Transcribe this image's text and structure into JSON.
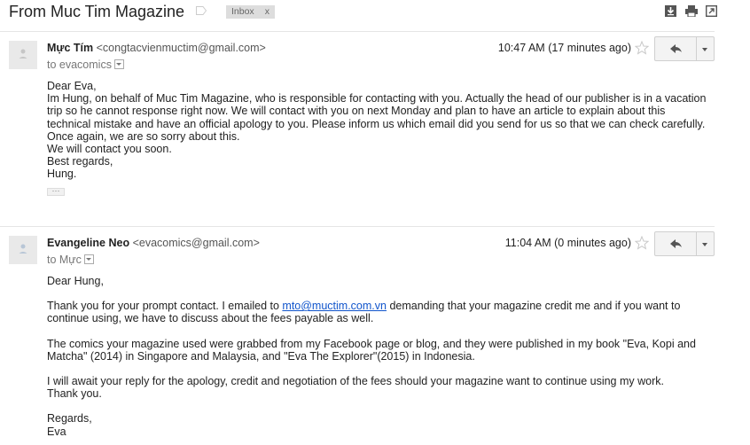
{
  "subject": "From Muc Tim Magazine",
  "label_chip": {
    "text": "Inbox",
    "close": "x"
  },
  "toolbar_icons": [
    "download-icon",
    "print-icon",
    "new-window-icon"
  ],
  "messages": [
    {
      "sender_name": "Mực Tím",
      "sender_email": "<congtacvienmuctim@gmail.com>",
      "recipient": "to evacomics",
      "time": "10:47 AM (17 minutes ago)",
      "body": [
        "Dear Eva,",
        "Im Hung, on behalf of Muc Tim Magazine, who is responsible for contacting with you. Actually the head of our publisher is in a vacation trip so he cannot response right now. We will contact with you on next Monday and plan to have an article to explain about this technical mistake and have an official apology to you. Please inform us which email did you send for us so that we can check carefully.",
        "Once again, we are so sorry about this.",
        "We will contact you soon.",
        "Best regards,",
        "Hung."
      ],
      "trimmed_content_indicator": "···"
    },
    {
      "sender_name": "Evangeline Neo",
      "sender_email": "<evacomics@gmail.com>",
      "recipient": "to Mực",
      "time": "11:04 AM (0 minutes ago)",
      "greeting": "Dear Hung,",
      "p1_before": "Thank you for your prompt contact. I emailed to ",
      "p1_link": "mto@muctim.com.vn",
      "p1_after": " demanding that your magazine credit me and if you want to continue using, we have to discuss about the fees payable as well.",
      "p2": "The comics your magazine used were grabbed from my Facebook page or blog, and they were published in my book \"Eva, Kopi and Matcha\" (2014) in Singapore and Malaysia, and \"Eva The Explorer\"(2015) in Indonesia.",
      "p3_line1": "I will await your reply for the apology, credit and negotiation of the fees should your magazine want to continue using my work.",
      "p3_line2": "Thank you.",
      "closing": "Regards,",
      "signature": "Eva"
    }
  ],
  "colors": {
    "link": "#1155cc",
    "chip_bg": "#dddddd",
    "button_bg": "#f3f3f3"
  }
}
